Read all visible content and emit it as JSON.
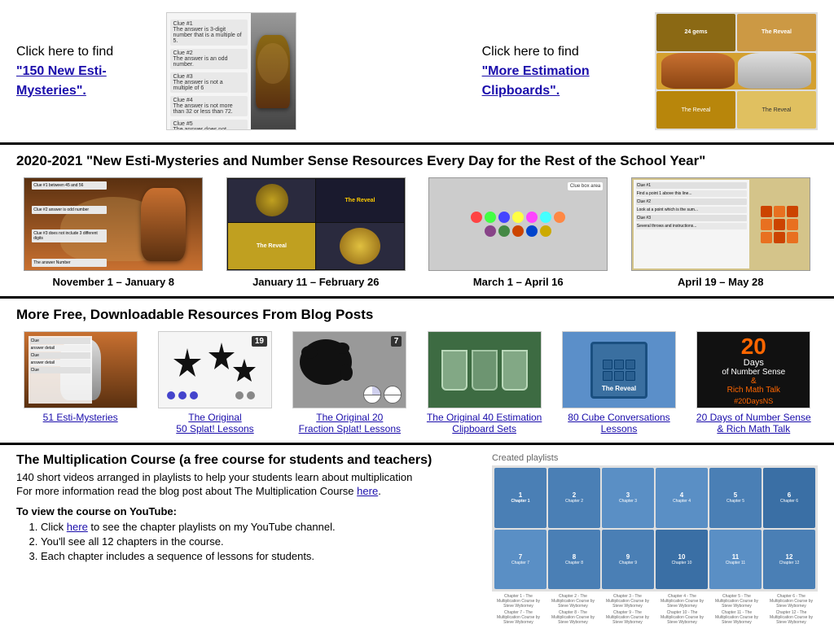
{
  "top": {
    "left_text_line1": "Click here to find",
    "left_link_text": "\"150 New Esti-Mysteries\".",
    "right_text_line1": "Click here to find",
    "right_link_text": "\"More Estimation Clipboards\"."
  },
  "section2": {
    "title": "2020-2021 \"New Esti-Mysteries and Number Sense Resources Every Day for the Rest of the School Year\"",
    "items": [
      {
        "label": "November  1 – January 8"
      },
      {
        "label": "January 11 – February 26"
      },
      {
        "label": "March 1 – April 16"
      },
      {
        "label": "April 19 – May 28"
      }
    ]
  },
  "section3": {
    "title": "More Free, Downloadable Resources From Blog Posts",
    "items": [
      {
        "label": "51 Esti-Mysteries"
      },
      {
        "label": "The Original \n50 Splat! Lessons"
      },
      {
        "label": "The Original 20\nFraction Splat! Lessons"
      },
      {
        "label": "The Original 40 Estimation\nClipboard Sets"
      },
      {
        "label": "80 Cube Conversations\nLessons"
      },
      {
        "label": "20 Days of Number Sense\n& Rich Math Talk"
      }
    ]
  },
  "section4": {
    "title": "The Multiplication Course (a free course for students and teachers)",
    "line1": "140 short videos arranged in playlists to help your students learn about multiplication",
    "line2": "For more information read the blog post about The Multiplication Course ",
    "here_text": "here",
    "view_text": "To view the course on YouTube:",
    "steps": [
      {
        "text": "Click ",
        "link": "here",
        "rest": " to see the chapter playlists on my YouTube channel."
      },
      {
        "text": "You'll see all 12 chapters in the course."
      },
      {
        "text": "Each chapter includes a sequence of lessons for students."
      }
    ]
  },
  "days_card": {
    "big_num": "20",
    "line1": "Days",
    "line2": "of Number Sense",
    "ampersand": "&",
    "line3": "Rich Math Talk",
    "hashtag": "#20DaysNS"
  },
  "badge": {
    "value": "19"
  },
  "badge_seven": {
    "value": "7"
  }
}
